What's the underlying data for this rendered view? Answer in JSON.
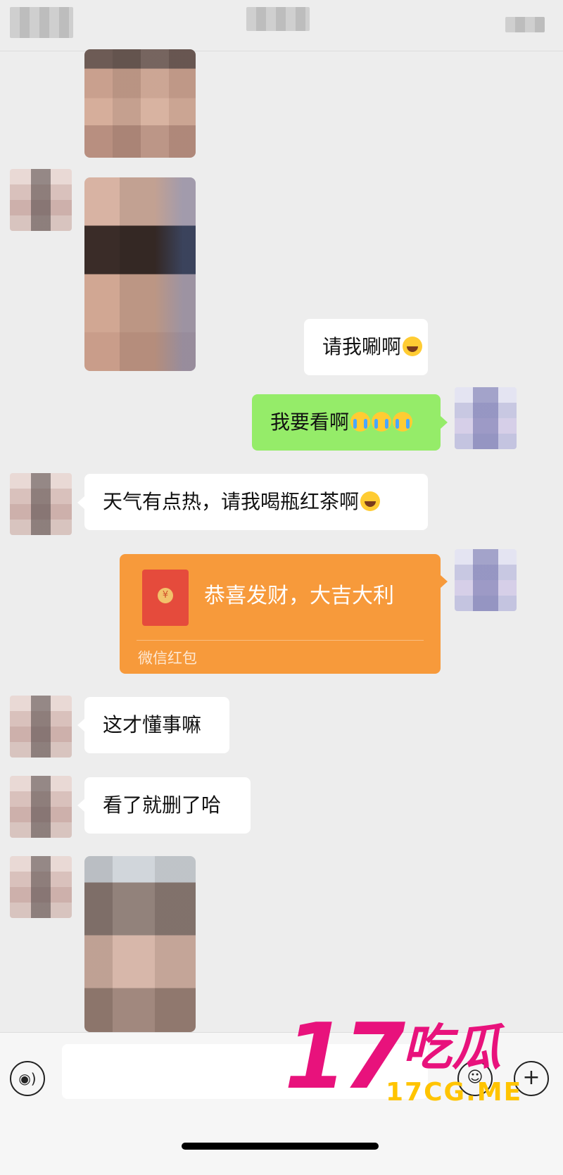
{
  "header": {},
  "messages": {
    "m1": {
      "text": "请我唰啊",
      "emoji": "laugh"
    },
    "m2": {
      "text": "我要看啊",
      "emoji": [
        "cry",
        "cry",
        "cry"
      ]
    },
    "m3": {
      "text": "天气有点热，请我喝瓶红茶啊",
      "emoji": "laugh"
    },
    "m5": {
      "text": "这才懂事嘛"
    },
    "m6": {
      "text": "看了就删了哈"
    }
  },
  "red_packet": {
    "coin": "¥",
    "greeting": "恭喜发财，大吉大利",
    "label": "微信红包"
  },
  "watermark": {
    "number": "17",
    "chinese": "吃瓜",
    "url": "17CG.ME"
  },
  "colors": {
    "chat_background": "#ededed",
    "sent_bubble": "#95ec69",
    "received_bubble": "#ffffff",
    "red_packet": "#f79a3b",
    "watermark_pink": "#e8127c",
    "watermark_yellow": "#ffc400"
  },
  "icons": {
    "voice": "voice-icon",
    "emoji": "emoji-icon",
    "plus": "plus-icon"
  }
}
